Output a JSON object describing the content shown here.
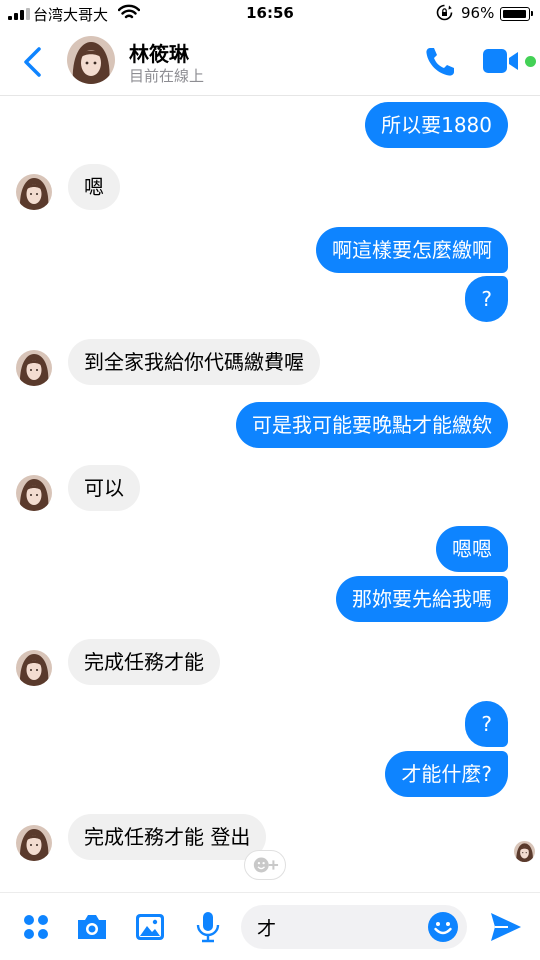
{
  "status_bar": {
    "carrier": "台湾大哥大",
    "time": "16:56",
    "battery_percent": "96%",
    "battery_level": 0.96
  },
  "header": {
    "contact_name": "林筱琳",
    "contact_status": "目前在線上"
  },
  "messages": [
    {
      "from": "me",
      "text": "所以要1880"
    },
    {
      "from": "them",
      "text": "嗯"
    },
    {
      "from": "me",
      "text": "啊這樣要怎麼繳啊"
    },
    {
      "from": "me",
      "text": "?"
    },
    {
      "from": "them",
      "text": "到全家我給你代碼繳費喔"
    },
    {
      "from": "me",
      "text": "可是我可能要晚點才能繳欸"
    },
    {
      "from": "them",
      "text": "可以"
    },
    {
      "from": "me",
      "text": "嗯嗯"
    },
    {
      "from": "me",
      "text": "那妳要先給我嗎"
    },
    {
      "from": "them",
      "text": "完成任務才能"
    },
    {
      "from": "me",
      "text": "?"
    },
    {
      "from": "me",
      "text": "才能什麼?"
    },
    {
      "from": "them",
      "text": "完成任務才能 登出"
    }
  ],
  "composer": {
    "input_value": "才"
  },
  "colors": {
    "accent": "#0e84ff",
    "incoming_bubble": "#f0f0f0",
    "online": "#43d156"
  },
  "icons": [
    "signal-icon",
    "wifi-icon",
    "rotation-lock-icon",
    "battery-icon",
    "back-icon",
    "phone-icon",
    "video-icon",
    "apps-icon",
    "camera-icon",
    "gallery-icon",
    "microphone-icon",
    "emoji-icon",
    "send-icon",
    "add-reaction-icon"
  ]
}
